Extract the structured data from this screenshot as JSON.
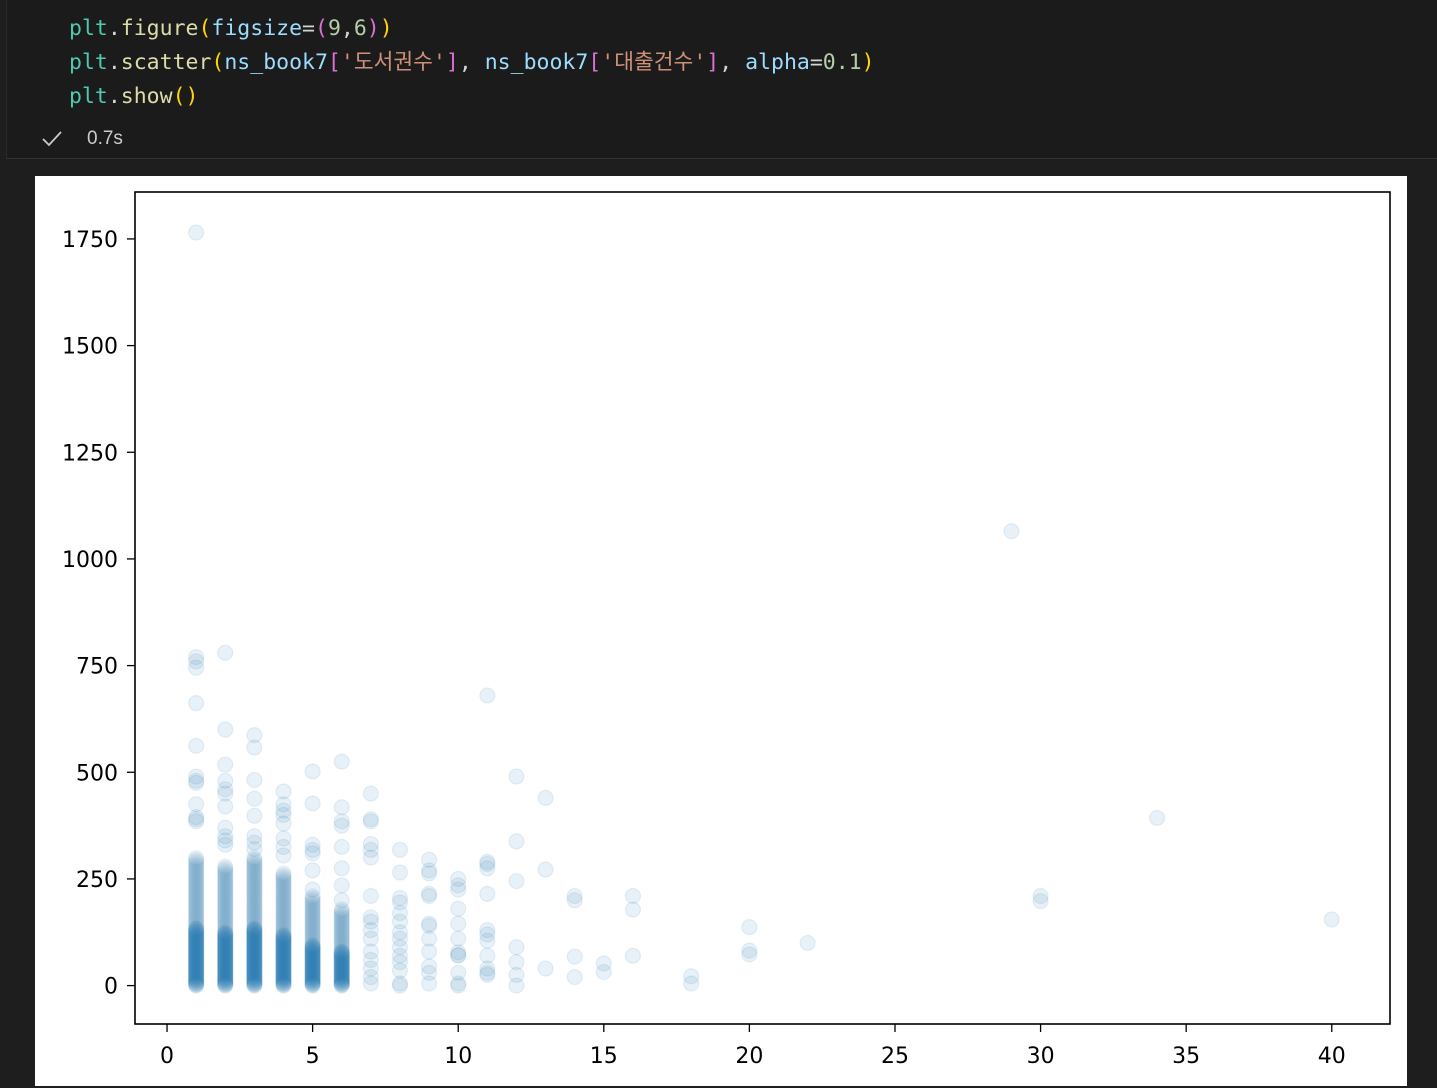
{
  "cell": {
    "code_lines": [
      [
        [
          "plt",
          "var"
        ],
        [
          ".",
          "op"
        ],
        [
          "figure",
          "fn"
        ],
        [
          "(",
          "p1"
        ],
        [
          "figsize",
          "prm"
        ],
        [
          "=",
          "op"
        ],
        [
          "(",
          "p2"
        ],
        [
          "9",
          "num"
        ],
        [
          ",",
          "op"
        ],
        [
          "6",
          "num"
        ],
        [
          ")",
          "p2"
        ],
        [
          ")",
          "p1"
        ]
      ],
      [
        [
          "plt",
          "var"
        ],
        [
          ".",
          "op"
        ],
        [
          "scatter",
          "fn"
        ],
        [
          "(",
          "p1"
        ],
        [
          "ns_book7",
          "prm"
        ],
        [
          "[",
          "p2"
        ],
        [
          "'도서권수'",
          "str"
        ],
        [
          "]",
          "p2"
        ],
        [
          ", ",
          "op"
        ],
        [
          "ns_book7",
          "prm"
        ],
        [
          "[",
          "p2"
        ],
        [
          "'대출건수'",
          "str"
        ],
        [
          "]",
          "p2"
        ],
        [
          ", ",
          "op"
        ],
        [
          "alpha",
          "prm"
        ],
        [
          "=",
          "op"
        ],
        [
          "0.1",
          "num"
        ],
        [
          ")",
          "p1"
        ]
      ],
      [
        [
          "plt",
          "var"
        ],
        [
          ".",
          "op"
        ],
        [
          "show",
          "fn"
        ],
        [
          "()",
          "p1"
        ]
      ]
    ],
    "status_icon": "checkmark-icon",
    "exec_time": "0.7s"
  },
  "chart_data": {
    "type": "scatter",
    "title": "",
    "xlabel": "",
    "ylabel": "",
    "xlim": [
      -1.1,
      42
    ],
    "ylim": [
      -90,
      1860
    ],
    "xticks": [
      0,
      5,
      10,
      15,
      20,
      25,
      30,
      35,
      40
    ],
    "yticks": [
      0,
      250,
      500,
      750,
      1000,
      1250,
      1500,
      1750
    ],
    "marker_color": "#1f77b4",
    "alpha": 0.1,
    "grid": false,
    "points": [
      [
        1,
        1765
      ],
      [
        1,
        770
      ],
      [
        1,
        760
      ],
      [
        1,
        745
      ],
      [
        1,
        662
      ],
      [
        1,
        562
      ],
      [
        1,
        490
      ],
      [
        1,
        480
      ],
      [
        1,
        475
      ],
      [
        1,
        425
      ],
      [
        1,
        395
      ],
      [
        1,
        390
      ],
      [
        1,
        385
      ],
      [
        2,
        780
      ],
      [
        2,
        600
      ],
      [
        2,
        518
      ],
      [
        2,
        480
      ],
      [
        2,
        460
      ],
      [
        2,
        450
      ],
      [
        2,
        420
      ],
      [
        2,
        370
      ],
      [
        2,
        350
      ],
      [
        2,
        340
      ],
      [
        2,
        330
      ],
      [
        3,
        587
      ],
      [
        3,
        558
      ],
      [
        3,
        482
      ],
      [
        3,
        438
      ],
      [
        3,
        398
      ],
      [
        3,
        350
      ],
      [
        3,
        335
      ],
      [
        3,
        320
      ],
      [
        4,
        455
      ],
      [
        4,
        425
      ],
      [
        4,
        410
      ],
      [
        4,
        400
      ],
      [
        4,
        380
      ],
      [
        4,
        345
      ],
      [
        4,
        325
      ],
      [
        4,
        305
      ],
      [
        5,
        502
      ],
      [
        5,
        427
      ],
      [
        5,
        330
      ],
      [
        5,
        318
      ],
      [
        5,
        310
      ],
      [
        5,
        270
      ],
      [
        5,
        225
      ],
      [
        6,
        525
      ],
      [
        6,
        418
      ],
      [
        6,
        385
      ],
      [
        6,
        375
      ],
      [
        6,
        325
      ],
      [
        6,
        275
      ],
      [
        6,
        235
      ],
      [
        6,
        200
      ],
      [
        7,
        450
      ],
      [
        7,
        390
      ],
      [
        7,
        385
      ],
      [
        7,
        332
      ],
      [
        7,
        318
      ],
      [
        7,
        300
      ],
      [
        7,
        210
      ],
      [
        7,
        160
      ],
      [
        7,
        150
      ],
      [
        7,
        130
      ],
      [
        7,
        110
      ],
      [
        7,
        80
      ],
      [
        7,
        60
      ],
      [
        7,
        40
      ],
      [
        7,
        20
      ],
      [
        7,
        5
      ],
      [
        8,
        318
      ],
      [
        8,
        265
      ],
      [
        8,
        205
      ],
      [
        8,
        195
      ],
      [
        8,
        170
      ],
      [
        8,
        150
      ],
      [
        8,
        125
      ],
      [
        8,
        110
      ],
      [
        8,
        90
      ],
      [
        8,
        70
      ],
      [
        8,
        55
      ],
      [
        8,
        35
      ],
      [
        8,
        5
      ],
      [
        8,
        0
      ],
      [
        9,
        295
      ],
      [
        9,
        270
      ],
      [
        9,
        263
      ],
      [
        9,
        215
      ],
      [
        9,
        210
      ],
      [
        9,
        145
      ],
      [
        9,
        140
      ],
      [
        9,
        110
      ],
      [
        9,
        80
      ],
      [
        9,
        45
      ],
      [
        9,
        30
      ],
      [
        9,
        5
      ],
      [
        10,
        250
      ],
      [
        10,
        235
      ],
      [
        10,
        225
      ],
      [
        10,
        180
      ],
      [
        10,
        145
      ],
      [
        10,
        110
      ],
      [
        10,
        78
      ],
      [
        10,
        72
      ],
      [
        10,
        70
      ],
      [
        10,
        30
      ],
      [
        10,
        5
      ],
      [
        10,
        0
      ],
      [
        11,
        680
      ],
      [
        11,
        290
      ],
      [
        11,
        285
      ],
      [
        11,
        275
      ],
      [
        11,
        215
      ],
      [
        11,
        130
      ],
      [
        11,
        120
      ],
      [
        11,
        105
      ],
      [
        11,
        70
      ],
      [
        11,
        40
      ],
      [
        11,
        30
      ],
      [
        11,
        25
      ],
      [
        12,
        490
      ],
      [
        12,
        338
      ],
      [
        12,
        245
      ],
      [
        12,
        90
      ],
      [
        12,
        55
      ],
      [
        12,
        25
      ],
      [
        12,
        0
      ],
      [
        13,
        440
      ],
      [
        13,
        272
      ],
      [
        13,
        40
      ],
      [
        14,
        210
      ],
      [
        14,
        200
      ],
      [
        14,
        68
      ],
      [
        14,
        20
      ],
      [
        15,
        52
      ],
      [
        15,
        32
      ],
      [
        16,
        210
      ],
      [
        16,
        178
      ],
      [
        16,
        70
      ],
      [
        18,
        22
      ],
      [
        18,
        5
      ],
      [
        20,
        137
      ],
      [
        20,
        82
      ],
      [
        20,
        73
      ],
      [
        22,
        100
      ],
      [
        29,
        1065
      ],
      [
        30,
        210
      ],
      [
        30,
        198
      ],
      [
        34,
        393
      ],
      [
        40,
        155
      ]
    ],
    "dense_columns": [
      {
        "x": 1,
        "max": 300
      },
      {
        "x": 2,
        "max": 280
      },
      {
        "x": 3,
        "max": 300
      },
      {
        "x": 4,
        "max": 265
      },
      {
        "x": 5,
        "max": 210
      },
      {
        "x": 6,
        "max": 180
      }
    ]
  }
}
